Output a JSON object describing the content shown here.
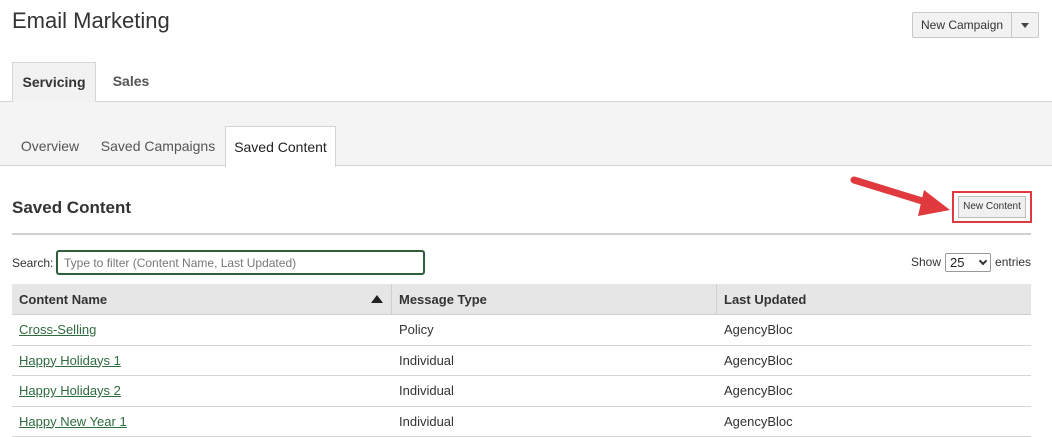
{
  "header": {
    "title": "Email Marketing",
    "new_campaign_label": "New Campaign"
  },
  "tabs_primary": [
    {
      "label": "Servicing",
      "active": true
    },
    {
      "label": "Sales",
      "active": false
    }
  ],
  "tabs_secondary": [
    {
      "label": "Overview",
      "active": false
    },
    {
      "label": "Saved Campaigns",
      "active": false
    },
    {
      "label": "Saved Content",
      "active": true
    }
  ],
  "section": {
    "title": "Saved Content",
    "new_content_label": "New Content"
  },
  "search": {
    "label": "Search:",
    "placeholder": "Type to filter (Content Name, Last Updated)"
  },
  "show_entries": {
    "show_label": "Show",
    "value": "25",
    "entries_label": "entries"
  },
  "table": {
    "columns": [
      "Content Name",
      "Message Type",
      "Last Updated"
    ],
    "sort": {
      "column": "Content Name",
      "direction": "ascending"
    },
    "rows": [
      {
        "name": "Cross-Selling",
        "type": "Policy",
        "updated": "AgencyBloc"
      },
      {
        "name": "Happy Holidays 1",
        "type": "Individual",
        "updated": "AgencyBloc"
      },
      {
        "name": "Happy Holidays 2",
        "type": "Individual",
        "updated": "AgencyBloc"
      },
      {
        "name": "Happy New Year 1",
        "type": "Individual",
        "updated": "AgencyBloc"
      }
    ]
  },
  "colors": {
    "link": "#2e6b3e",
    "annotation_red": "#e0393e",
    "input_border": "#2e5e3b"
  }
}
